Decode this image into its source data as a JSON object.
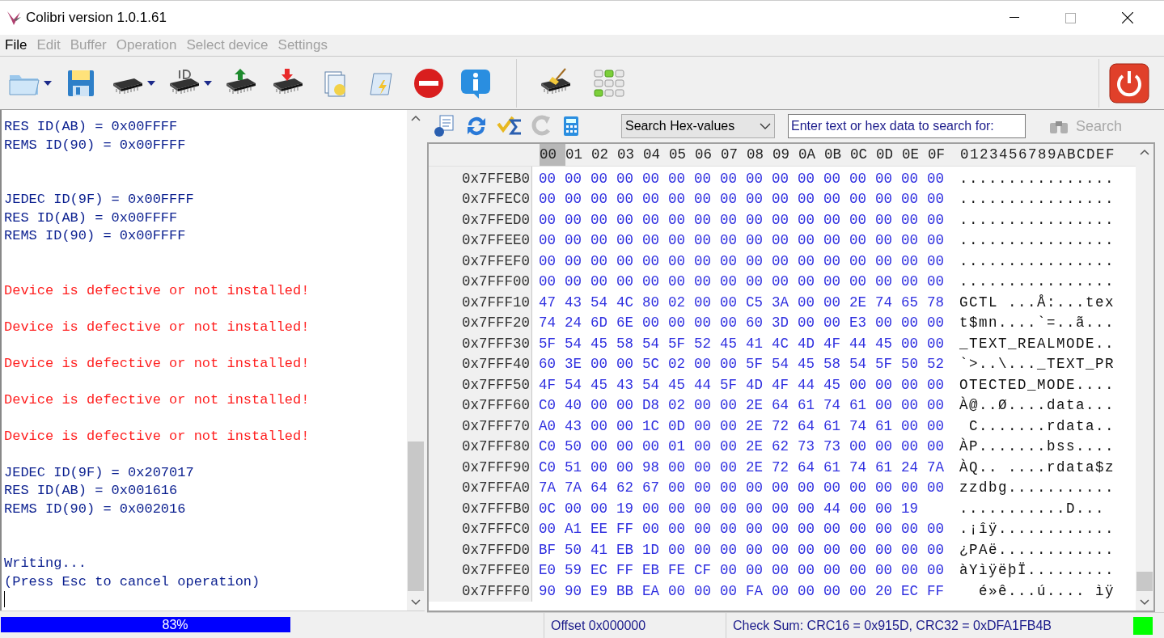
{
  "window": {
    "title": "Colibri version 1.0.1.61"
  },
  "menu": [
    {
      "label": "File",
      "disabled": false
    },
    {
      "label": "Edit",
      "disabled": true
    },
    {
      "label": "Buffer",
      "disabled": true
    },
    {
      "label": "Operation",
      "disabled": true
    },
    {
      "label": "Select device",
      "disabled": true
    },
    {
      "label": "Settings",
      "disabled": true
    }
  ],
  "log": [
    {
      "kind": "info",
      "text": "RES ID(AB) = 0x00FFFF"
    },
    {
      "kind": "info",
      "text": "REMS ID(90) = 0x00FFFF"
    },
    {
      "kind": "blank"
    },
    {
      "kind": "blank"
    },
    {
      "kind": "info",
      "text": "JEDEC ID(9F) = 0x00FFFF"
    },
    {
      "kind": "info",
      "text": "RES ID(AB) = 0x00FFFF"
    },
    {
      "kind": "info",
      "text": "REMS ID(90) = 0x00FFFF"
    },
    {
      "kind": "blank"
    },
    {
      "kind": "blank"
    },
    {
      "kind": "error",
      "text": "Device is defective or not installed!"
    },
    {
      "kind": "blank"
    },
    {
      "kind": "error",
      "text": "Device is defective or not installed!"
    },
    {
      "kind": "blank"
    },
    {
      "kind": "error",
      "text": "Device is defective or not installed!"
    },
    {
      "kind": "blank"
    },
    {
      "kind": "error",
      "text": "Device is defective or not installed!"
    },
    {
      "kind": "blank"
    },
    {
      "kind": "error",
      "text": "Device is defective or not installed!"
    },
    {
      "kind": "blank"
    },
    {
      "kind": "info",
      "text": "JEDEC ID(9F) = 0x207017"
    },
    {
      "kind": "info",
      "text": "RES ID(AB) = 0x001616"
    },
    {
      "kind": "info",
      "text": "REMS ID(90) = 0x002016"
    },
    {
      "kind": "blank"
    },
    {
      "kind": "blank"
    },
    {
      "kind": "info",
      "text": "Writing..."
    },
    {
      "kind": "info",
      "text": "(Press Esc to cancel operation)"
    }
  ],
  "progress": {
    "level": 0.83,
    "label": "83%"
  },
  "hex_toolbar": {
    "search_mode": "Search Hex-values",
    "search_placeholder": "Enter text or hex data to search for:",
    "search_button": "Search"
  },
  "hex_header": {
    "columns": [
      {
        "label": "00",
        "selected": true
      },
      {
        "label": "01",
        "selected": false
      },
      {
        "label": "02",
        "selected": false
      },
      {
        "label": "03",
        "selected": false
      },
      {
        "label": "04",
        "selected": false
      },
      {
        "label": "05",
        "selected": false
      },
      {
        "label": "06",
        "selected": false
      },
      {
        "label": "07",
        "selected": false
      },
      {
        "label": "08",
        "selected": false
      },
      {
        "label": "09",
        "selected": false
      },
      {
        "label": "0A",
        "selected": false
      },
      {
        "label": "0B",
        "selected": false
      },
      {
        "label": "0C",
        "selected": false
      },
      {
        "label": "0D",
        "selected": false
      },
      {
        "label": "0E",
        "selected": false
      },
      {
        "label": "0F",
        "selected": false
      }
    ],
    "ascii": "0123456789ABCDEF"
  },
  "hex_rows": [
    {
      "offset": "0x7FFEB0",
      "bytes": [
        "00",
        "00",
        "00",
        "00",
        "00",
        "00",
        "00",
        "00",
        "00",
        "00",
        "00",
        "00",
        "00",
        "00",
        "00",
        "00"
      ],
      "ascii": "................"
    },
    {
      "offset": "0x7FFEC0",
      "bytes": [
        "00",
        "00",
        "00",
        "00",
        "00",
        "00",
        "00",
        "00",
        "00",
        "00",
        "00",
        "00",
        "00",
        "00",
        "00",
        "00"
      ],
      "ascii": "................"
    },
    {
      "offset": "0x7FFED0",
      "bytes": [
        "00",
        "00",
        "00",
        "00",
        "00",
        "00",
        "00",
        "00",
        "00",
        "00",
        "00",
        "00",
        "00",
        "00",
        "00",
        "00"
      ],
      "ascii": "................"
    },
    {
      "offset": "0x7FFEE0",
      "bytes": [
        "00",
        "00",
        "00",
        "00",
        "00",
        "00",
        "00",
        "00",
        "00",
        "00",
        "00",
        "00",
        "00",
        "00",
        "00",
        "00"
      ],
      "ascii": "................"
    },
    {
      "offset": "0x7FFEF0",
      "bytes": [
        "00",
        "00",
        "00",
        "00",
        "00",
        "00",
        "00",
        "00",
        "00",
        "00",
        "00",
        "00",
        "00",
        "00",
        "00",
        "00"
      ],
      "ascii": "................"
    },
    {
      "offset": "0x7FFF00",
      "bytes": [
        "00",
        "00",
        "00",
        "00",
        "00",
        "00",
        "00",
        "00",
        "00",
        "00",
        "00",
        "00",
        "00",
        "00",
        "00",
        "00"
      ],
      "ascii": "................"
    },
    {
      "offset": "0x7FFF10",
      "bytes": [
        "47",
        "43",
        "54",
        "4C",
        "80",
        "02",
        "00",
        "00",
        "C5",
        "3A",
        "00",
        "00",
        "2E",
        "74",
        "65",
        "78"
      ],
      "ascii": "GCTL ...Å:...tex"
    },
    {
      "offset": "0x7FFF20",
      "bytes": [
        "74",
        "24",
        "6D",
        "6E",
        "00",
        "00",
        "00",
        "00",
        "60",
        "3D",
        "00",
        "00",
        "E3",
        "00",
        "00",
        "00"
      ],
      "ascii": "t$mn....`=..ã..."
    },
    {
      "offset": "0x7FFF30",
      "bytes": [
        "5F",
        "54",
        "45",
        "58",
        "54",
        "5F",
        "52",
        "45",
        "41",
        "4C",
        "4D",
        "4F",
        "44",
        "45",
        "00",
        "00"
      ],
      "ascii": "_TEXT_REALMODE.."
    },
    {
      "offset": "0x7FFF40",
      "bytes": [
        "60",
        "3E",
        "00",
        "00",
        "5C",
        "02",
        "00",
        "00",
        "5F",
        "54",
        "45",
        "58",
        "54",
        "5F",
        "50",
        "52"
      ],
      "ascii": "`>..\\..._TEXT_PR"
    },
    {
      "offset": "0x7FFF50",
      "bytes": [
        "4F",
        "54",
        "45",
        "43",
        "54",
        "45",
        "44",
        "5F",
        "4D",
        "4F",
        "44",
        "45",
        "00",
        "00",
        "00",
        "00"
      ],
      "ascii": "OTECTED_MODE...."
    },
    {
      "offset": "0x7FFF60",
      "bytes": [
        "C0",
        "40",
        "00",
        "00",
        "D8",
        "02",
        "00",
        "00",
        "2E",
        "64",
        "61",
        "74",
        "61",
        "00",
        "00",
        "00"
      ],
      "ascii": "À@..Ø....data..."
    },
    {
      "offset": "0x7FFF70",
      "bytes": [
        "A0",
        "43",
        "00",
        "00",
        "1C",
        "0D",
        "00",
        "00",
        "2E",
        "72",
        "64",
        "61",
        "74",
        "61",
        "00",
        "00"
      ],
      "ascii": " C.......rdata.."
    },
    {
      "offset": "0x7FFF80",
      "bytes": [
        "C0",
        "50",
        "00",
        "00",
        "00",
        "01",
        "00",
        "00",
        "2E",
        "62",
        "73",
        "73",
        "00",
        "00",
        "00",
        "00"
      ],
      "ascii": "ÀP.......bss...."
    },
    {
      "offset": "0x7FFF90",
      "bytes": [
        "C0",
        "51",
        "00",
        "00",
        "98",
        "00",
        "00",
        "00",
        "2E",
        "72",
        "64",
        "61",
        "74",
        "61",
        "24",
        "7A"
      ],
      "ascii": "ÀQ.. ....rdata$z"
    },
    {
      "offset": "0x7FFFA0",
      "bytes": [
        "7A",
        "7A",
        "64",
        "62",
        "67",
        "00",
        "00",
        "00",
        "00",
        "00",
        "00",
        "00",
        "00",
        "00",
        "00",
        "00"
      ],
      "ascii": "zzdbg..........."
    },
    {
      "offset": "0x7FFFB0",
      "bytes": [
        "0C",
        "00",
        "00",
        "19",
        "00",
        "00",
        "00",
        "00",
        "00",
        "00",
        "00",
        "44",
        "00",
        "00",
        "19"
      ],
      "ascii": "...........D..."
    },
    {
      "offset": "0x7FFFC0",
      "bytes": [
        "00",
        "A1",
        "EE",
        "FF",
        "00",
        "00",
        "00",
        "00",
        "00",
        "00",
        "00",
        "00",
        "00",
        "00",
        "00",
        "00"
      ],
      "ascii": ".¡îÿ............"
    },
    {
      "offset": "0x7FFFD0",
      "bytes": [
        "BF",
        "50",
        "41",
        "EB",
        "1D",
        "00",
        "00",
        "00",
        "00",
        "00",
        "00",
        "00",
        "00",
        "00",
        "00",
        "00"
      ],
      "ascii": "¿PAë............"
    },
    {
      "offset": "0x7FFFE0",
      "bytes": [
        "E0",
        "59",
        "EC",
        "FF",
        "EB",
        "FE",
        "CF",
        "00",
        "00",
        "00",
        "00",
        "00",
        "00",
        "00",
        "00",
        "00"
      ],
      "ascii": "àYìÿëþÏ........."
    },
    {
      "offset": "0x7FFFF0",
      "bytes": [
        "90",
        "90",
        "E9",
        "BB",
        "EA",
        "00",
        "00",
        "00",
        "FA",
        "00",
        "00",
        "00",
        "00",
        "20",
        "EC",
        "FF"
      ],
      "ascii": "  é»ê...ú.... ìÿ"
    }
  ],
  "status": {
    "offset": "Offset 0x000000",
    "checksum": "Check Sum: CRC16 = 0x915D, CRC32 = 0xDFA1FB4B",
    "ok": true
  }
}
